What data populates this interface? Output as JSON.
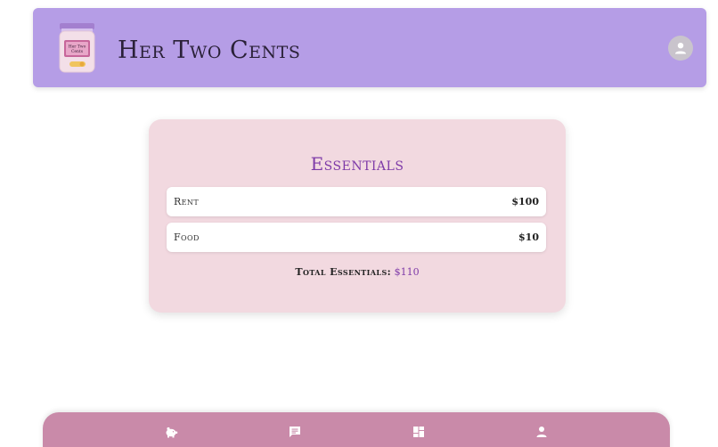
{
  "header": {
    "app_title": "Her Two Cents",
    "logo_text_line1": "Her Two",
    "logo_text_line2": "Cents"
  },
  "card": {
    "title": "Essentials",
    "expenses": [
      {
        "label": "Rent",
        "amount": "$100"
      },
      {
        "label": "Food",
        "amount": "$10"
      }
    ],
    "total_label": "Total Essentials:",
    "total_value": "$110"
  },
  "nav": {
    "items": [
      {
        "icon": "piggy-bank-icon"
      },
      {
        "icon": "chat-icon"
      },
      {
        "icon": "dashboard-icon"
      },
      {
        "icon": "person-icon"
      }
    ]
  },
  "colors": {
    "header_bg": "#b59de6",
    "card_bg": "#f2d9e0",
    "accent_purple": "#7e3aa8",
    "nav_bg": "#c98aa9"
  }
}
